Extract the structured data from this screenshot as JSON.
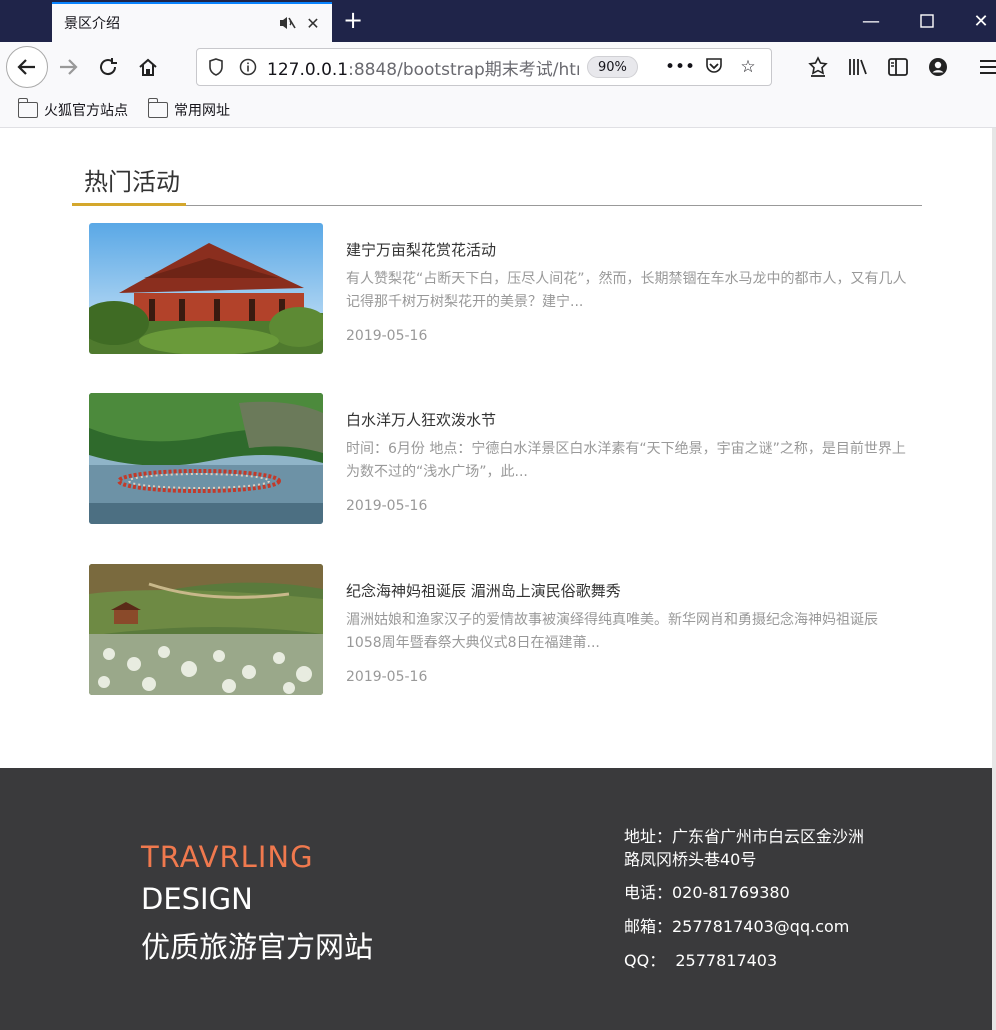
{
  "browser": {
    "tab_title": "景区介绍",
    "url_host": "127.0.0.1",
    "url_rest": ":8848/bootstrap期末考试/htm",
    "zoom": "90%",
    "bookmarks": [
      "火狐官方站点",
      "常用网址"
    ]
  },
  "section": {
    "title": "热门活动"
  },
  "articles": [
    {
      "title": "建宁万亩梨花赏花活动",
      "desc": "有人赞梨花“占断天下白，压尽人间花”，然而，长期禁锢在车水马龙中的都市人，又有几人记得那千树万树梨花开的美景？建宁...",
      "date": "2019-05-16"
    },
    {
      "title": "白水洋万人狂欢泼水节",
      "desc": "时间：6月份 地点：宁德白水洋景区白水洋素有“天下绝景，宇宙之谜”之称，是目前世界上为数不过的“浅水广场”，此...",
      "date": "2019-05-16"
    },
    {
      "title": "纪念海神妈祖诞辰 湄洲岛上演民俗歌舞秀",
      "desc": "湄洲姑娘和渔家汉子的爱情故事被演绎得纯真唯美。新华网肖和勇摄纪念海神妈祖诞辰1058周年暨春祭大典仪式8日在福建莆...",
      "date": "2019-05-16"
    }
  ],
  "footer": {
    "brand_line1": "TRAVRLING",
    "brand_line2": "DESIGN",
    "brand_line3": "优质旅游官方网站",
    "address_line1": "地址：广东省广州市白云区金沙洲",
    "address_line2": "路凤冈桥头巷40号",
    "phone": "电话：020-81769380",
    "email": "邮箱：2577817403@qq.com",
    "qq": "QQ：  2577817403"
  },
  "colors": {
    "accent_gold": "#d4a72c",
    "brand_orange": "#f0794e",
    "footer_bg": "#3a3a3c",
    "titlebar_bg": "#1f2449"
  }
}
